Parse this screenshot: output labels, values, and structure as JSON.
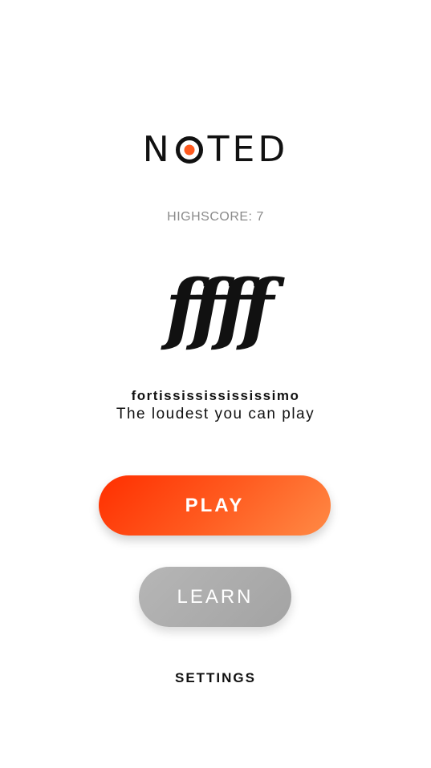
{
  "logo": {
    "before": "N",
    "after": "TED",
    "accent_color": "#ff5a1f"
  },
  "highscore": {
    "text": "HIGHSCORE: 7"
  },
  "dynamic": {
    "symbol": "ffff",
    "term": "fortissississississimo",
    "definition": "The loudest you can play"
  },
  "buttons": {
    "play_label": "PLAY",
    "learn_label": "LEARN",
    "settings_label": "SETTINGS"
  },
  "colors": {
    "play_gradient_start": "#ff2f00",
    "play_gradient_end": "#ff8a45",
    "learn_gray": "#a9a9a9",
    "text": "#111111",
    "muted_text": "#8a8a8a"
  }
}
